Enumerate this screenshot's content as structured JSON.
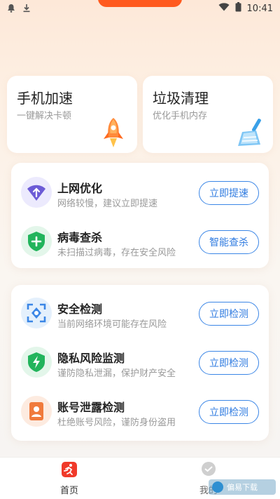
{
  "status_bar": {
    "time": "10:41"
  },
  "quick_actions": [
    {
      "title": "手机加速",
      "subtitle": "一键解决卡顿"
    },
    {
      "title": "垃圾清理",
      "subtitle": "优化手机内存"
    }
  ],
  "group1": [
    {
      "name": "上网优化",
      "desc": "网络较慢，建议立即提速",
      "button": "立即提速",
      "icon": "wifi-up-icon",
      "color": "#6c5bd6"
    },
    {
      "name": "病毒查杀",
      "desc": "未扫描过病毒，存在安全风险",
      "button": "智能查杀",
      "icon": "shield-plus-icon",
      "color": "#22b45c"
    }
  ],
  "group2": [
    {
      "name": "安全检测",
      "desc": "当前网络环境可能存在风险",
      "button": "立即检测",
      "icon": "scan-icon",
      "color": "#3b86e6"
    },
    {
      "name": "隐私风险监测",
      "desc": "谨防隐私泄漏，保护财产安全",
      "button": "立即检测",
      "icon": "shield-bolt-icon",
      "color": "#22b45c"
    },
    {
      "name": "账号泄露检测",
      "desc": "杜绝账号风险，谨防身份盗用",
      "button": "立即检测",
      "icon": "id-card-icon",
      "color": "#f07a3c"
    }
  ],
  "nav": {
    "home": "首页",
    "mine": "我的"
  },
  "watermark": "偏易下载"
}
